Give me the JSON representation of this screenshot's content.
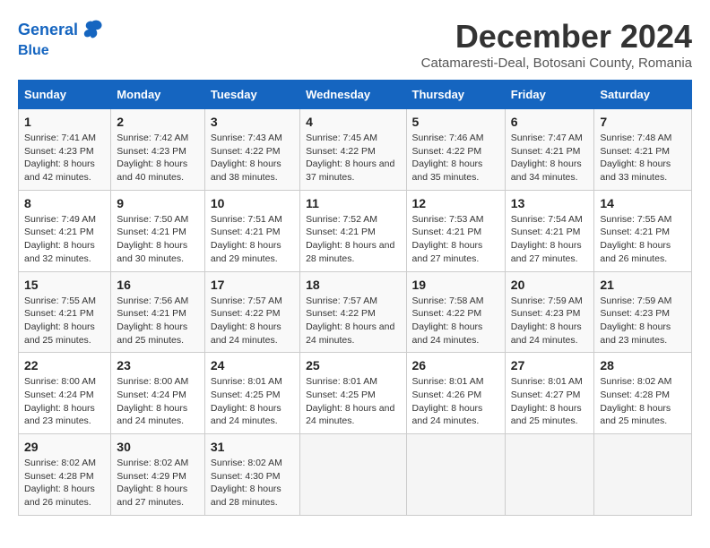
{
  "header": {
    "logo_line1": "General",
    "logo_line2": "Blue",
    "month_title": "December 2024",
    "subtitle": "Catamaresti-Deal, Botosani County, Romania"
  },
  "weekdays": [
    "Sunday",
    "Monday",
    "Tuesday",
    "Wednesday",
    "Thursday",
    "Friday",
    "Saturday"
  ],
  "weeks": [
    [
      {
        "day": "1",
        "sunrise": "7:41 AM",
        "sunset": "4:23 PM",
        "daylight": "8 hours and 42 minutes."
      },
      {
        "day": "2",
        "sunrise": "7:42 AM",
        "sunset": "4:23 PM",
        "daylight": "8 hours and 40 minutes."
      },
      {
        "day": "3",
        "sunrise": "7:43 AM",
        "sunset": "4:22 PM",
        "daylight": "8 hours and 38 minutes."
      },
      {
        "day": "4",
        "sunrise": "7:45 AM",
        "sunset": "4:22 PM",
        "daylight": "8 hours and 37 minutes."
      },
      {
        "day": "5",
        "sunrise": "7:46 AM",
        "sunset": "4:22 PM",
        "daylight": "8 hours and 35 minutes."
      },
      {
        "day": "6",
        "sunrise": "7:47 AM",
        "sunset": "4:21 PM",
        "daylight": "8 hours and 34 minutes."
      },
      {
        "day": "7",
        "sunrise": "7:48 AM",
        "sunset": "4:21 PM",
        "daylight": "8 hours and 33 minutes."
      }
    ],
    [
      {
        "day": "8",
        "sunrise": "7:49 AM",
        "sunset": "4:21 PM",
        "daylight": "8 hours and 32 minutes."
      },
      {
        "day": "9",
        "sunrise": "7:50 AM",
        "sunset": "4:21 PM",
        "daylight": "8 hours and 30 minutes."
      },
      {
        "day": "10",
        "sunrise": "7:51 AM",
        "sunset": "4:21 PM",
        "daylight": "8 hours and 29 minutes."
      },
      {
        "day": "11",
        "sunrise": "7:52 AM",
        "sunset": "4:21 PM",
        "daylight": "8 hours and 28 minutes."
      },
      {
        "day": "12",
        "sunrise": "7:53 AM",
        "sunset": "4:21 PM",
        "daylight": "8 hours and 27 minutes."
      },
      {
        "day": "13",
        "sunrise": "7:54 AM",
        "sunset": "4:21 PM",
        "daylight": "8 hours and 27 minutes."
      },
      {
        "day": "14",
        "sunrise": "7:55 AM",
        "sunset": "4:21 PM",
        "daylight": "8 hours and 26 minutes."
      }
    ],
    [
      {
        "day": "15",
        "sunrise": "7:55 AM",
        "sunset": "4:21 PM",
        "daylight": "8 hours and 25 minutes."
      },
      {
        "day": "16",
        "sunrise": "7:56 AM",
        "sunset": "4:21 PM",
        "daylight": "8 hours and 25 minutes."
      },
      {
        "day": "17",
        "sunrise": "7:57 AM",
        "sunset": "4:22 PM",
        "daylight": "8 hours and 24 minutes."
      },
      {
        "day": "18",
        "sunrise": "7:57 AM",
        "sunset": "4:22 PM",
        "daylight": "8 hours and 24 minutes."
      },
      {
        "day": "19",
        "sunrise": "7:58 AM",
        "sunset": "4:22 PM",
        "daylight": "8 hours and 24 minutes."
      },
      {
        "day": "20",
        "sunrise": "7:59 AM",
        "sunset": "4:23 PM",
        "daylight": "8 hours and 24 minutes."
      },
      {
        "day": "21",
        "sunrise": "7:59 AM",
        "sunset": "4:23 PM",
        "daylight": "8 hours and 23 minutes."
      }
    ],
    [
      {
        "day": "22",
        "sunrise": "8:00 AM",
        "sunset": "4:24 PM",
        "daylight": "8 hours and 23 minutes."
      },
      {
        "day": "23",
        "sunrise": "8:00 AM",
        "sunset": "4:24 PM",
        "daylight": "8 hours and 24 minutes."
      },
      {
        "day": "24",
        "sunrise": "8:01 AM",
        "sunset": "4:25 PM",
        "daylight": "8 hours and 24 minutes."
      },
      {
        "day": "25",
        "sunrise": "8:01 AM",
        "sunset": "4:25 PM",
        "daylight": "8 hours and 24 minutes."
      },
      {
        "day": "26",
        "sunrise": "8:01 AM",
        "sunset": "4:26 PM",
        "daylight": "8 hours and 24 minutes."
      },
      {
        "day": "27",
        "sunrise": "8:01 AM",
        "sunset": "4:27 PM",
        "daylight": "8 hours and 25 minutes."
      },
      {
        "day": "28",
        "sunrise": "8:02 AM",
        "sunset": "4:28 PM",
        "daylight": "8 hours and 25 minutes."
      }
    ],
    [
      {
        "day": "29",
        "sunrise": "8:02 AM",
        "sunset": "4:28 PM",
        "daylight": "8 hours and 26 minutes."
      },
      {
        "day": "30",
        "sunrise": "8:02 AM",
        "sunset": "4:29 PM",
        "daylight": "8 hours and 27 minutes."
      },
      {
        "day": "31",
        "sunrise": "8:02 AM",
        "sunset": "4:30 PM",
        "daylight": "8 hours and 28 minutes."
      },
      null,
      null,
      null,
      null
    ]
  ]
}
